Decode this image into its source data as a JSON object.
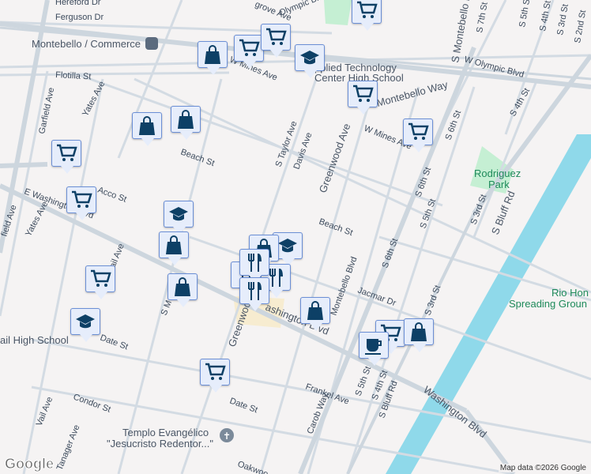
{
  "map": {
    "streets": {
      "hereford": "Hereford Dr",
      "ferguson": "Ferguson Dr",
      "flotilla": "Flotilla St",
      "garfield": "Garfield Ave",
      "yates": "Yates Ave",
      "yates2": "Yates Ave",
      "garfield2": "field Ave",
      "beach": "Beach St",
      "beach2": "Beach St",
      "acco": "Acco St",
      "ewash": "E Washington Blvd",
      "wmines": "W Mines Ave",
      "wmines2": "W Mines Ave",
      "grove": "grove Ave",
      "olympic": "Olympic Blvd",
      "wolympic": "W Olympic Blvd",
      "staylor": "S Taylor Ave",
      "davis": "Davis Ave",
      "greenwood": "Greenwood Ave",
      "greenwood2": "Greenwood Ave",
      "montebelloway": "Montebello Way",
      "smontebello": "S Montebello Blvd",
      "montebello2": "Montebello Blvd",
      "s6th": "S 6th St",
      "s6th2": "S 6th St",
      "s6th3": "S 6th St",
      "s5th": "S 5th St",
      "s5th2": "S 5th St",
      "s5th3": "S 5th St",
      "s4th": "S 4th St",
      "s4th2": "S 4th St",
      "s4th3": "S 4th St",
      "s3rd": "S 3rd St",
      "s3rd2": "S 3rd St",
      "s3rd3": "S 3rd St",
      "s2nd": "S 2nd St",
      "s7th": "S 7th St",
      "sbluff": "S Bluff Rd",
      "sbluff2": "S Bluff Rd",
      "washington": "Washington Blvd",
      "washington2": "ashington Blvd",
      "jacmar": "Jacmar Dr",
      "frankel": "Frankel Ave",
      "carob": "Carob Way",
      "date": "Date St",
      "date2": "Date St",
      "condor": "Condor St",
      "vail": "Vail Ave",
      "vail2": "ail Ave",
      "tanager": "Tanager Ave",
      "oakwood": "Oakwoo",
      "sm": "S M"
    },
    "places": {
      "station": "Montebello / Commerce",
      "school1a": "pplied Technology",
      "school1b": "Center High School",
      "school2": "ail High School",
      "park1a": "Rodriguez",
      "park1b": "Park",
      "park2a": "Rio Hon",
      "park2b": "Spreading Groun",
      "church1": "Templo Evangélico",
      "church2": "\"Jesucristo Redentor...\""
    },
    "attribution": "Map data ©2026 Google",
    "logo": "Google"
  },
  "colors": {
    "marker_bg": "#e6edfb",
    "marker_icon": "#0d4066",
    "river": "#8fd9ea",
    "park": "#c5efd3"
  }
}
